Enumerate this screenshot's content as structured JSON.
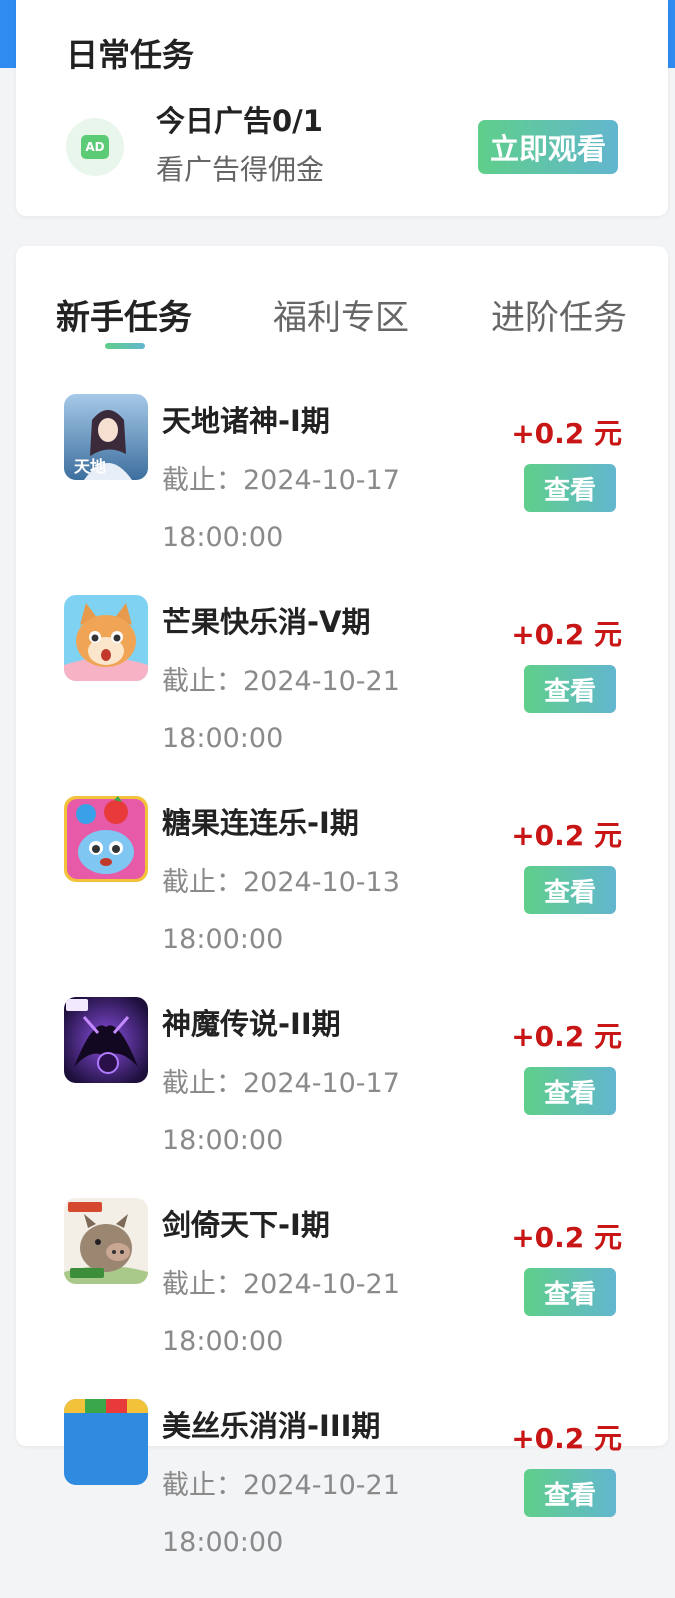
{
  "daily": {
    "title": "日常任务",
    "ad_icon_label": "AD",
    "ad_title": "今日广告0/1",
    "ad_subtitle": "看广告得佣金",
    "watch_button": "立即观看",
    "accent_color": "#5fcf8a"
  },
  "tabs": [
    {
      "label": "新手任务",
      "active": true
    },
    {
      "label": "福利专区",
      "active": false
    },
    {
      "label": "进阶任务",
      "active": false
    }
  ],
  "tasks": [
    {
      "name": "天地诸神-I期",
      "deadline_label": "截止：2024-10-17",
      "deadline_time": "18:00:00",
      "reward": "+0.2 元",
      "button": "查看",
      "icon": "fantasy-game-icon"
    },
    {
      "name": "芒果快乐消-V期",
      "deadline_label": "截止：2024-10-21",
      "deadline_time": "18:00:00",
      "reward": "+0.2 元",
      "button": "查看",
      "icon": "cat-puzzle-game-icon"
    },
    {
      "name": "糖果连连乐-I期",
      "deadline_label": "截止：2024-10-13",
      "deadline_time": "18:00:00",
      "reward": "+0.2 元",
      "button": "查看",
      "icon": "candy-match-game-icon"
    },
    {
      "name": "神魔传说-II期",
      "deadline_label": "截止：2024-10-17",
      "deadline_time": "18:00:00",
      "reward": "+0.2 元",
      "button": "查看",
      "icon": "dark-fantasy-game-icon"
    },
    {
      "name": "剑倚天下-I期",
      "deadline_label": "截止：2024-10-21",
      "deadline_time": "18:00:00",
      "reward": "+0.2 元",
      "button": "查看",
      "icon": "boar-game-icon"
    },
    {
      "name": "美丝乐消消-III期",
      "deadline_label": "截止：2024-10-21",
      "deadline_time": "18:00:00",
      "reward": "+0.2 元",
      "button": "查看",
      "icon": "block-puzzle-game-icon"
    }
  ],
  "colors": {
    "reward": "#c81616",
    "button_gradient_start": "#5fcf8a",
    "button_gradient_end": "#62b6cf",
    "top_band": "#2f8bf0"
  }
}
